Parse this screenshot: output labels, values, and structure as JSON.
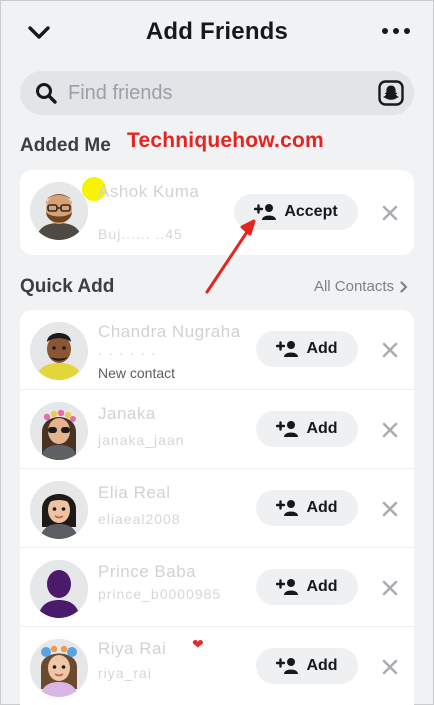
{
  "header": {
    "title": "Add Friends"
  },
  "search": {
    "placeholder": "Find friends"
  },
  "sections": {
    "added_me": "Added Me",
    "quick_add": "Quick Add",
    "all_contacts": "All Contacts"
  },
  "watermark": "Techniquehow.com",
  "added_me": [
    {
      "name": "Ashok Kuma",
      "sub": "Buj...... ..45",
      "action": "Accept",
      "avatar": "bearded-man-glasses"
    }
  ],
  "quick_add": [
    {
      "name": "Chandra Nugraha",
      "sub": "New contact",
      "action": "Add",
      "avatar": "man-yellow-hoodie"
    },
    {
      "name": "Janaka",
      "sub": "janaka_jaan",
      "action": "Add",
      "avatar": "woman-sunglasses-flowers"
    },
    {
      "name": "Elia Real",
      "sub": "eliaeal2008",
      "action": "Add",
      "avatar": "woman-dark-hair"
    },
    {
      "name": "Prince Baba",
      "sub": "prince_b0000985",
      "action": "Add",
      "avatar": "silhouette"
    },
    {
      "name": "Riya Rai",
      "sub": "riya_rai",
      "action": "Add",
      "avatar": "woman-flower-crown"
    }
  ],
  "colors": {
    "background": "#f1f2f4",
    "card": "#ffffff",
    "watermark": "#e52420",
    "arrow": "#e52420",
    "badge": "#f6f400"
  }
}
